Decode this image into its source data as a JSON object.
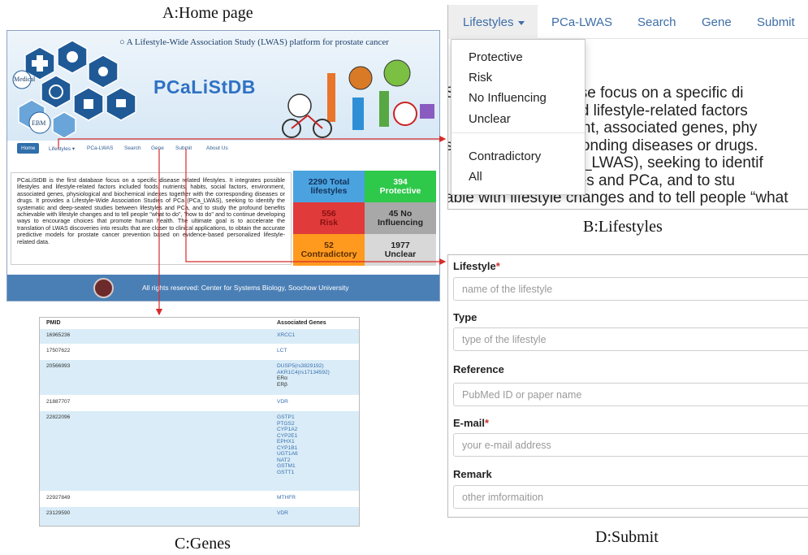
{
  "captions": {
    "a": "A:Home page",
    "b": "B:Lifestyles",
    "c": "C:Genes",
    "d": "D:Submit"
  },
  "home": {
    "tagline": "A Lifestyle-Wide Association Study (LWAS) platform for prostate cancer",
    "logo": "PCaLiStDB",
    "hex_labels": [
      "Medical",
      "EBM"
    ],
    "nav": [
      "Home",
      "Lifestyles ▾",
      "PCa-LWAS",
      "Search",
      "Gene",
      "Submit",
      "About Us"
    ],
    "description": "PCaLiStDB is the first database focus on a specific disease related lifestyles. It integrates possible lifestyles and lifestyle-related factors included foods, nutrients, habits, social factors, environment, associated genes, physiological and biochemical indexes together with the corresponding diseases or drugs. It provides a Lifestyle-Wide Association Studies of PCa (PCa_LWAS), seeking to identify the systematic and deep-seated studies between lifestyles and PCa, and to study the profound benefits achievable with lifestyle changes and to tell people \"what to do\", \"how to do\" and to continue developing ways to encourage choices that promote human health. The ultimate goal is to accelerate the translation of LWAS discoveries into results that are closer to clinical applications, to obtain the accurate predictive models for prostate cancer prevention based on evidence-based personalized lifestyle-related data.",
    "stats": [
      {
        "value": "2290 Total",
        "label": "lifestyles",
        "bg": "#4aa3df",
        "color": "#14315a"
      },
      {
        "value": "394",
        "label": "Protective",
        "bg": "#2ec84a",
        "color": "#ffffff"
      },
      {
        "value": "556",
        "label": "Risk",
        "bg": "#e03a3a",
        "color": "#8a1010"
      },
      {
        "value": "45 No",
        "label": "Influencing",
        "bg": "#a8a8a8",
        "color": "#222222"
      },
      {
        "value": "52",
        "label": "Contradictory",
        "bg": "#ff9a1f",
        "color": "#5a2e00"
      },
      {
        "value": "1977",
        "label": "Unclear",
        "bg": "#d8d8d8",
        "color": "#222222"
      }
    ],
    "footer": "All rights reserved: Center for Systems Biology, Soochow University"
  },
  "lifestyles": {
    "nav": [
      "Lifestyles",
      "PCa-LWAS",
      "Search",
      "Gene",
      "Submit"
    ],
    "dropdown": [
      "Protective",
      "Risk",
      "No Influencing",
      "Unclear",
      "Contradictory",
      "All"
    ],
    "bg_lines": [
      "S                    atabase focus on a specific di",
      "                      les and lifestyle-related factors",
      "                     ironment, associated genes, phy",
      "s                  corresponding diseases or drugs.",
      "                     a (PCa_LWAS), seeking to identif",
      "                     lifestyles and PCa, and to stu",
      "able with lifestyle changes and to tell people “what"
    ]
  },
  "genes": {
    "headers": [
      "PMID",
      "Associated Genes"
    ],
    "rows": [
      {
        "pmid": "16965236",
        "genes": [
          "XRCC1"
        ]
      },
      {
        "pmid": "17507622",
        "genes": [
          "LCT"
        ]
      },
      {
        "pmid": "20566993",
        "genes": [
          "DUSP5(rs3829192)",
          "AKR1C4(rs17134592)",
          "ERα",
          "ERβ"
        ]
      },
      {
        "pmid": "21887707",
        "genes": [
          "VDR"
        ]
      },
      {
        "pmid": "22822096",
        "genes": [
          "GSTP1",
          "PTGS2",
          "CYP1A2",
          "CYP2E1",
          "EPHX1",
          "CYP1B1",
          "UGT1A6",
          "NAT2",
          "GSTM1",
          "GSTT1"
        ]
      },
      {
        "pmid": "22927849",
        "genes": [
          "MTHFR"
        ]
      },
      {
        "pmid": "23129590",
        "genes": [
          "VDR"
        ]
      }
    ]
  },
  "submit": {
    "fields": [
      {
        "label": "Lifestyle",
        "required": true,
        "placeholder": "name of the lifestyle"
      },
      {
        "label": "Type",
        "required": false,
        "placeholder": "type of the lifestyle"
      },
      {
        "label": "Reference",
        "required": false,
        "placeholder": "PubMed ID or paper name"
      },
      {
        "label": "E-mail",
        "required": true,
        "placeholder": "your e-mail address"
      },
      {
        "label": "Remark",
        "required": false,
        "placeholder": "other imformaition"
      }
    ]
  },
  "colors": {
    "link": "#3d6ea8",
    "arrow": "#d62b2b",
    "table_row_alt": "#d9ecf7",
    "footer": "#4a7fb5"
  }
}
